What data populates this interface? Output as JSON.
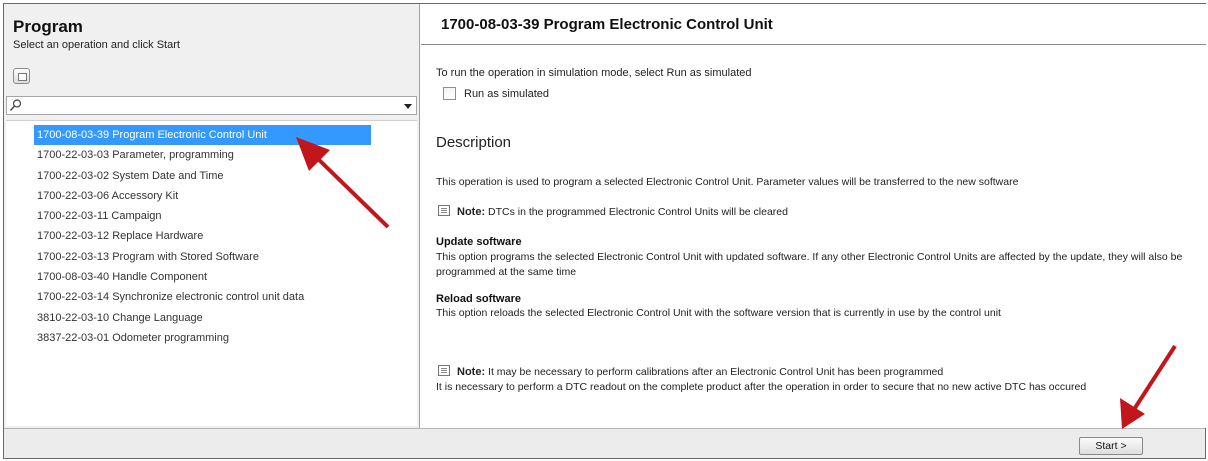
{
  "left_panel": {
    "title": "Program",
    "subtitle": "Select an operation and click Start",
    "search": {
      "value": "",
      "placeholder": ""
    },
    "operations": [
      "1700-08-03-39 Program Electronic Control Unit",
      "1700-22-03-03 Parameter, programming",
      "1700-22-03-02 System Date and Time",
      "1700-22-03-06 Accessory Kit",
      "1700-22-03-11 Campaign",
      "1700-22-03-12 Replace Hardware",
      "1700-22-03-13 Program with Stored Software",
      "1700-08-03-40 Handle Component",
      "1700-22-03-14 Synchronize electronic control unit data",
      "3810-22-03-10 Change Language",
      "3837-22-03-01 Odometer programming"
    ],
    "selected_index": 0
  },
  "right_panel": {
    "title": "1700-08-03-39 Program Electronic Control Unit",
    "simulation_text": "To run the operation in simulation mode, select Run as simulated",
    "run_as_simulated_label": "Run as simulated",
    "run_as_simulated_checked": false,
    "description_heading": "Description",
    "description_text": "This operation is used to program a selected Electronic Control Unit. Parameter values will be transferred to the new software",
    "note1_label": "Note:",
    "note1_text": " DTCs in the programmed Electronic Control Units will be cleared",
    "update_heading": "Update software",
    "update_text": "This option programs the selected Electronic Control Unit with updated software. If any other Electronic Control Units are affected by the update, they will also be programmed at the same time",
    "reload_heading": "Reload software",
    "reload_text": "This option reloads the selected Electronic Control Unit with the software version that is currently in use by the control unit",
    "note2_label": "Note:",
    "note2_text": " It may be necessary to perform calibrations after an Electronic Control Unit has been programmed",
    "note2_extra": "It is necessary to perform a DTC readout on the complete product after the operation in order to secure that no new active DTC has occured"
  },
  "bottom_bar": {
    "start_label": "Start >"
  },
  "colors": {
    "selection": "#3399ff",
    "annotation_arrow": "#c0161c"
  }
}
